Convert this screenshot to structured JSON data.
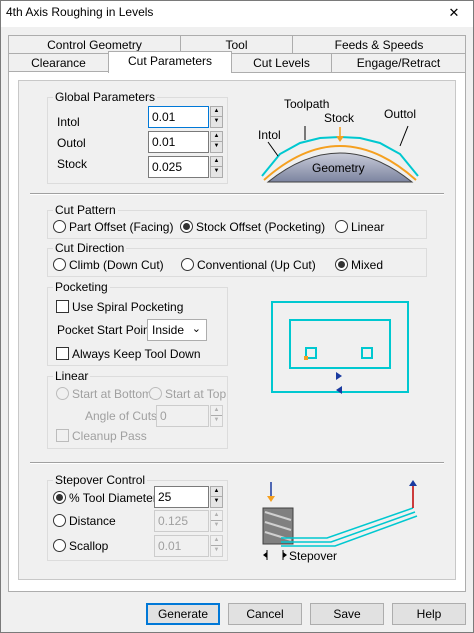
{
  "window": {
    "title": "4th Axis Roughing in Levels",
    "close_glyph": "✕"
  },
  "tabs": {
    "row1": [
      "Control Geometry",
      "Tool",
      "Feeds & Speeds"
    ],
    "row2": [
      "Clearance",
      "Cut Parameters",
      "Cut Levels",
      "Engage/Retract"
    ],
    "selected": "Cut Parameters"
  },
  "global": {
    "title": "Global Parameters",
    "intol_label": "Intol",
    "intol_value": "0.01",
    "outol_label": "Outol",
    "outol_value": "0.01",
    "stock_label": "Stock",
    "stock_value": "0.025",
    "diagram": {
      "toolpath": "Toolpath",
      "stock": "Stock",
      "outtol": "Outtol",
      "intol": "Intol",
      "geometry": "Geometry"
    }
  },
  "cut_pattern": {
    "title": "Cut Pattern",
    "options": [
      "Part Offset (Facing)",
      "Stock Offset (Pocketing)",
      "Linear"
    ],
    "selected": 1
  },
  "cut_direction": {
    "title": "Cut Direction",
    "options": [
      "Climb (Down Cut)",
      "Conventional (Up Cut)",
      "Mixed"
    ],
    "selected": 2
  },
  "pocketing": {
    "title": "Pocketing",
    "spiral_label": "Use Spiral Pocketing",
    "start_point_label": "Pocket Start Point",
    "start_point_value": "Inside",
    "keep_down_label": "Always Keep Tool Down"
  },
  "linear": {
    "title": "Linear",
    "start_bottom": "Start at Bottom",
    "start_top": "Start at Top",
    "angle_label": "Angle of Cuts",
    "angle_value": "0",
    "cleanup_label": "Cleanup Pass"
  },
  "stepover": {
    "title": "Stepover Control",
    "tool_diam_label": "% Tool Diameter",
    "tool_diam_value": "25",
    "distance_label": "Distance",
    "distance_value": "0.125",
    "scallop_label": "Scallop",
    "scallop_value": "0.01",
    "diagram_label": "Stepover"
  },
  "buttons": {
    "generate": "Generate",
    "cancel": "Cancel",
    "save": "Save",
    "help": "Help"
  },
  "colors": {
    "accent": "#0078d7",
    "diagram_cyan": "#00c8d0",
    "diagram_orange": "#f5a020"
  }
}
